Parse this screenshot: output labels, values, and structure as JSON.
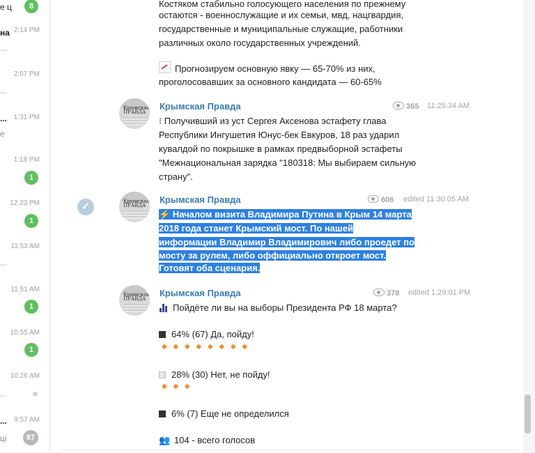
{
  "sidebar": {
    "chats": [
      {
        "time": "",
        "snippet": "e ц",
        "snippet2": "",
        "badge": "8",
        "badge_style": "green"
      },
      {
        "time": "2:14 PM",
        "snippet": "на",
        "snippet2": "...",
        "badge": ""
      },
      {
        "time": "2:07 PM",
        "snippet": "",
        "snippet2": "...",
        "badge": ""
      },
      {
        "time": "1:31 PM",
        "snippet": "...",
        "snippet2": "e",
        "badge": ""
      },
      {
        "time": "1:18 PM",
        "snippet": "",
        "snippet2": "",
        "badge": "1",
        "badge_style": "green"
      },
      {
        "time": "12:23 PM",
        "snippet": "",
        "snippet2": "",
        "badge": "1",
        "badge_style": "green"
      },
      {
        "time": "11:53 AM",
        "snippet": "",
        "snippet2": "...",
        "badge": ""
      },
      {
        "time": "11:51 AM",
        "snippet": "",
        "snippet2": "",
        "badge": "1",
        "badge_style": "green"
      },
      {
        "time": "10:55 AM",
        "snippet": "",
        "snippet2": "",
        "badge": "1",
        "badge_style": "green"
      },
      {
        "time": "10:26 AM",
        "snippet": "",
        "snippet2": "...",
        "badge": ""
      },
      {
        "time": "9:57 AM",
        "snippet": "...",
        "snippet2": "ці",
        "badge": "87",
        "badge_style": "grey"
      }
    ]
  },
  "prev_message": {
    "lines": [
      "Костяком стабильно голосующего населения по прежнему",
      "остаются - военнослужащие и их семьи, мвд, нацгвардия,",
      "государственные и муниципальные служащие, работники",
      "различных около государственных учреждений."
    ],
    "forecast_lines": [
      "Прогнозируем основную явку — 65-70% из них,",
      "проголосовавших за основного кандидата — 60-65%"
    ]
  },
  "messages": [
    {
      "author": "Крымская Правда",
      "views": "365",
      "time": "11:25:34 AM",
      "lines": [
        "⁝ Получивший из уст Сергея Аксенова эстафету глава",
        "Республики Ингушетия Юнус-бек Евкуров, 18 раз ударил",
        "кувалдой по покрышке в рамках предвыборной эстафеты",
        "\"Межнациональная зарядка \"180318: Мы выбираем сильную",
        "страну\"."
      ]
    },
    {
      "author": "Крымская Правда",
      "views": "606",
      "time": "edited 11:30:05 AM",
      "lines": [
        " Началом визита Владимира Путина в Крым 14 марта ",
        "2018 года станет Крымский мост. По нашей ",
        "информации Владимир Владимирович либо проедет по ",
        "мосту за рулем, либо оффициально откроет мост. ",
        "Готовят оба сценария."
      ]
    },
    {
      "author": "Крымская Правда",
      "views": "378",
      "time": "edited 1:29:01 PM",
      "question": "Пойдёте ли вы на выборы Президента РФ 18 марта?",
      "options": [
        {
          "text": "64% (67) Да, пойду!",
          "diamonds": "◆◆◆◆◆◆◆◆",
          "shade": "dark"
        },
        {
          "text": "28% (30) Нет, не пойду!",
          "diamonds": "◆◆◆",
          "shade": "light"
        },
        {
          "text": "6% (7) Еще не определился",
          "diamonds": "",
          "shade": "dark"
        }
      ],
      "total": "104 - всего голосов"
    }
  ],
  "avatar_text": "Крымская ПРАВДА",
  "colors": {
    "selection": "#2e81e0",
    "author": "#3b7ab1",
    "badge_green": "#5fbf5f",
    "badge_grey": "#b4b9bd"
  },
  "icons": [
    "eye-icon",
    "checkmark-icon",
    "lightning-icon",
    "chart-icon",
    "people-icon",
    "chart-increasing-icon",
    "orange-diamond-icon"
  ]
}
